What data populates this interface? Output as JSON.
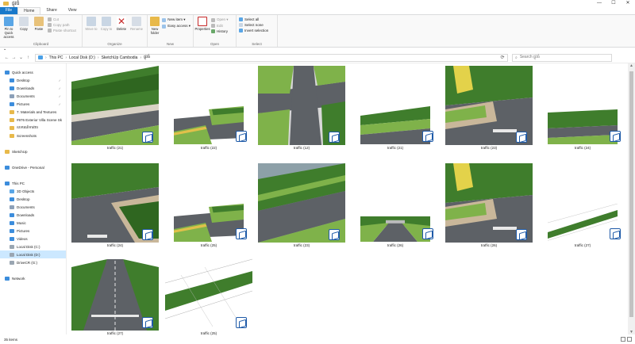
{
  "window": {
    "title": "ផ្លូវធំ",
    "controls": [
      "—",
      "☐",
      "✕"
    ]
  },
  "ribbon_tabs": [
    "File",
    "Home",
    "Share",
    "View"
  ],
  "ribbon": {
    "clipboard": {
      "label": "Clipboard",
      "pin": "Pin to Quick access",
      "copy": "Copy",
      "paste": "Paste",
      "cut": "Cut",
      "copy_path": "Copy path",
      "paste_shortcut": "Paste shortcut"
    },
    "organize": {
      "label": "Organize",
      "move_to": "Move to",
      "copy_to": "Copy to",
      "delete": "Delete",
      "rename": "Rename"
    },
    "new": {
      "label": "New",
      "new_folder": "New folder",
      "new_item": "New item ▾",
      "easy_access": "Easy access ▾"
    },
    "open": {
      "label": "Open",
      "properties": "Properties",
      "open": "Open ▾",
      "edit": "Edit",
      "history": "History"
    },
    "select": {
      "label": "Select",
      "select_all": "Select all",
      "select_none": "Select none",
      "invert": "Invert selection"
    }
  },
  "addressbar": {
    "back": "←",
    "forward": "→",
    "recent": "⌄",
    "up": "↑",
    "path": [
      "This PC",
      "Local Disk (D:)",
      "SketchUp Cambodia",
      "ផ្លូវធំ"
    ],
    "search_placeholder": "Search ផ្លូវធំ"
  },
  "navpane": [
    {
      "label": "Quick access",
      "icon": "star",
      "color": "#3c8ddc",
      "indent": 0,
      "pin": false
    },
    {
      "label": "Desktop",
      "icon": "desktop",
      "color": "#3c8ddc",
      "indent": 1,
      "pin": true
    },
    {
      "label": "Downloads",
      "icon": "download",
      "color": "#3c8ddc",
      "indent": 1,
      "pin": true
    },
    {
      "label": "Documents",
      "icon": "document",
      "color": "#8ca0b8",
      "indent": 1,
      "pin": true
    },
    {
      "label": "Pictures",
      "icon": "pictures",
      "color": "#3c8ddc",
      "indent": 1,
      "pin": true
    },
    {
      "label": "7. Materials and Textures",
      "icon": "folder",
      "color": "#e8b94a",
      "indent": 1,
      "pin": false
    },
    {
      "label": "#976 Exterior Villa Scene Sk",
      "icon": "folder",
      "color": "#e8b94a",
      "indent": 1,
      "pin": false
    },
    {
      "label": "ឧបករណ៍ការងារ",
      "icon": "folder",
      "color": "#e8b94a",
      "indent": 1,
      "pin": false
    },
    {
      "label": "Screenshots",
      "icon": "folder",
      "color": "#e8b94a",
      "indent": 1,
      "pin": false
    },
    {
      "label": "",
      "icon": "",
      "color": "",
      "indent": 0,
      "pin": false
    },
    {
      "label": "SketchUp",
      "icon": "folder",
      "color": "#e8b94a",
      "indent": 0,
      "pin": false
    },
    {
      "label": "",
      "icon": "",
      "color": "",
      "indent": 0,
      "pin": false
    },
    {
      "label": "OneDrive - Personal",
      "icon": "cloud",
      "color": "#3c8ddc",
      "indent": 0,
      "pin": false
    },
    {
      "label": "",
      "icon": "",
      "color": "",
      "indent": 0,
      "pin": false
    },
    {
      "label": "This PC",
      "icon": "pc",
      "color": "#3c8ddc",
      "indent": 0,
      "pin": false
    },
    {
      "label": "3D Objects",
      "icon": "3d",
      "color": "#5aa6e6",
      "indent": 1,
      "pin": false
    },
    {
      "label": "Desktop",
      "icon": "desktop",
      "color": "#3c8ddc",
      "indent": 1,
      "pin": false
    },
    {
      "label": "Documents",
      "icon": "document",
      "color": "#8ca0b8",
      "indent": 1,
      "pin": false
    },
    {
      "label": "Downloads",
      "icon": "download",
      "color": "#3c8ddc",
      "indent": 1,
      "pin": false
    },
    {
      "label": "Music",
      "icon": "music",
      "color": "#3c8ddc",
      "indent": 1,
      "pin": false
    },
    {
      "label": "Pictures",
      "icon": "pictures",
      "color": "#3c8ddc",
      "indent": 1,
      "pin": false
    },
    {
      "label": "Videos",
      "icon": "videos",
      "color": "#3c8ddc",
      "indent": 1,
      "pin": false
    },
    {
      "label": "Local Disk (C:)",
      "icon": "disk",
      "color": "#9aa6b2",
      "indent": 1,
      "pin": false
    },
    {
      "label": "Local Disk (D:)",
      "icon": "disk",
      "color": "#9aa6b2",
      "indent": 1,
      "pin": false,
      "selected": true
    },
    {
      "label": "DriveCR (G:)",
      "icon": "disk",
      "color": "#9aa6b2",
      "indent": 1,
      "pin": false
    },
    {
      "label": "",
      "icon": "",
      "color": "",
      "indent": 0,
      "pin": false
    },
    {
      "label": "Network",
      "icon": "network",
      "color": "#3c8ddc",
      "indent": 0,
      "pin": false
    }
  ],
  "files": [
    {
      "name": "traffic (21)",
      "style": "trees-close"
    },
    {
      "name": "traffic (22)",
      "style": "corner-small"
    },
    {
      "name": "traffic (12)",
      "style": "intersection-top"
    },
    {
      "name": "traffic (21)",
      "style": "roadside-small"
    },
    {
      "name": "traffic (23)",
      "style": "trees-crossing"
    },
    {
      "name": "traffic (24)",
      "style": "street-view"
    },
    {
      "name": "traffic (24)",
      "style": "trees-corner"
    },
    {
      "name": "traffic (25)",
      "style": "corner-small"
    },
    {
      "name": "traffic (23)",
      "style": "aerial-road"
    },
    {
      "name": "traffic (26)",
      "style": "gate-view"
    },
    {
      "name": "traffic (26)",
      "style": "trees-crossing"
    },
    {
      "name": "traffic (27)",
      "style": "wire-strip"
    },
    {
      "name": "traffic (27)",
      "style": "road-perspective"
    },
    {
      "name": "traffic (25)",
      "style": "wireframe"
    }
  ],
  "status": {
    "count": "35 items"
  },
  "colors": {
    "accent": "#1979ca",
    "selection": "#cce8ff",
    "sketchup_badge": "#1e5aa8"
  }
}
